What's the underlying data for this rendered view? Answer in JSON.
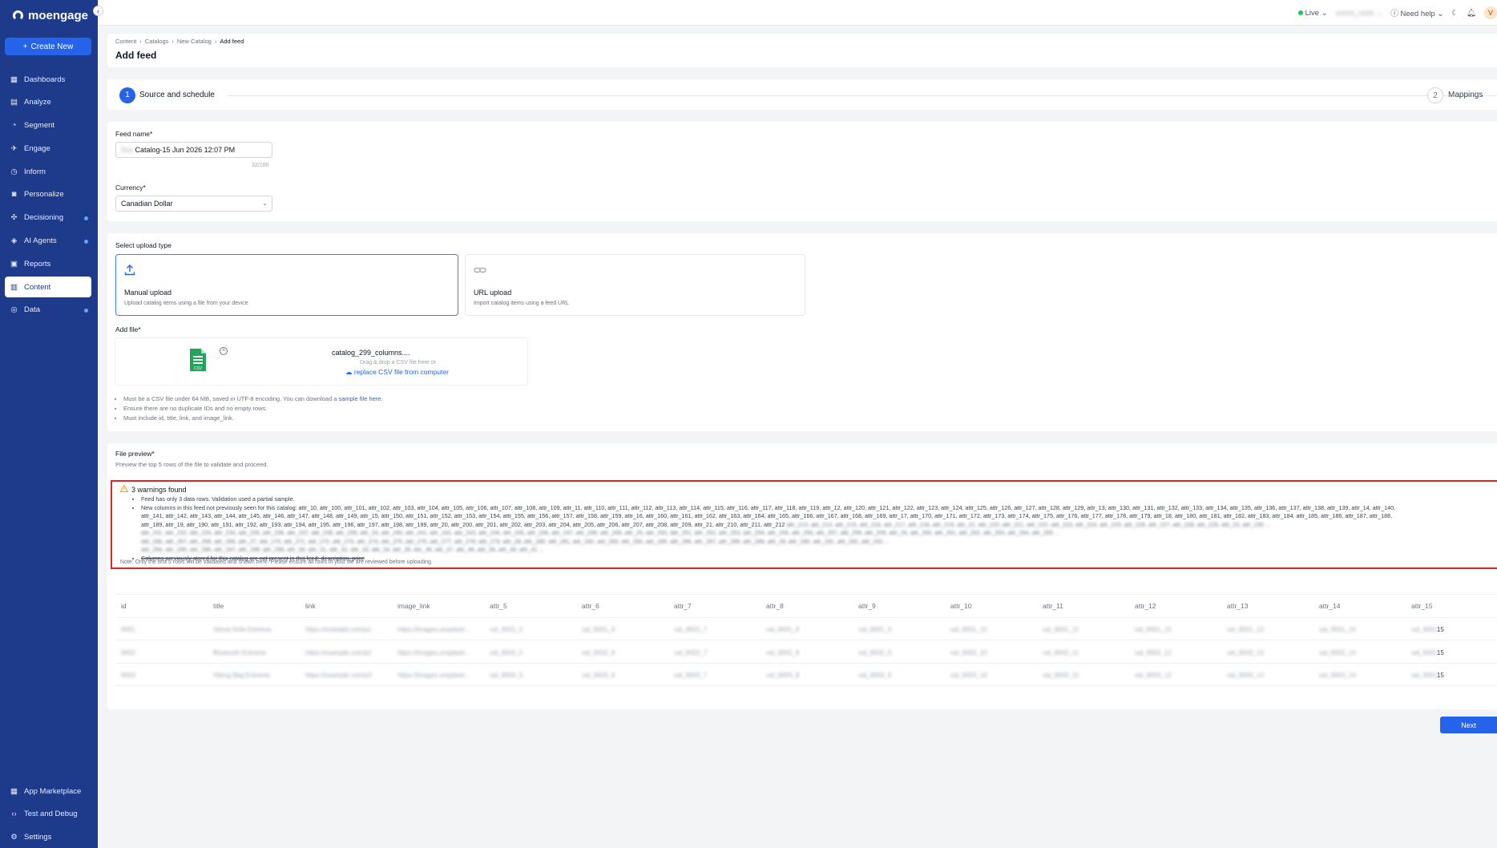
{
  "sidebar": {
    "brand": "moengage",
    "create_label": "Create New",
    "items": [
      {
        "label": "Dashboards",
        "icon": "dashboard-icon"
      },
      {
        "label": "Analyze",
        "icon": "analyze-icon"
      },
      {
        "label": "Segment",
        "icon": "segment-icon"
      },
      {
        "label": "Engage",
        "icon": "engage-icon"
      },
      {
        "label": "Inform",
        "icon": "inform-icon"
      },
      {
        "label": "Personalize",
        "icon": "personalize-icon"
      },
      {
        "label": "Decisioning",
        "icon": "decisioning-icon"
      },
      {
        "label": "AI Agents",
        "icon": "ai-agents-icon"
      },
      {
        "label": "Reports",
        "icon": "reports-icon"
      },
      {
        "label": "Content",
        "icon": "content-icon"
      },
      {
        "label": "Data",
        "icon": "data-icon"
      }
    ],
    "bottom_items": [
      {
        "label": "App Marketplace",
        "icon": "marketplace-icon"
      },
      {
        "label": "Test and Debug",
        "icon": "code-icon"
      },
      {
        "label": "Settings",
        "icon": "gear-icon"
      }
    ]
  },
  "topbar": {
    "env": "Live",
    "need_help": "Need help",
    "avatar_initial": "V"
  },
  "header": {
    "breadcrumb": [
      "Content",
      "Catalogs",
      "New Catalog",
      "Add feed"
    ],
    "title": "Add feed"
  },
  "stepper": {
    "step1_num": "1",
    "step1_label": "Source and schedule",
    "step2_num": "2",
    "step2_label": "Mappings"
  },
  "form": {
    "feed_name_label": "Feed name*",
    "feed_name_value": "Catalog-15 Jun 2026 12:07 PM",
    "feed_name_counter": "32/100",
    "currency_label": "Currency*",
    "currency_value": "Canadian Dollar"
  },
  "upload": {
    "section_label": "Select upload type",
    "manual_title": "Manual upload",
    "manual_desc": "Upload catalog items using a file from your device",
    "url_title": "URL upload",
    "url_desc": "Import catalog items using a feed URL",
    "add_file_label": "Add file*",
    "file_name": "catalog_299_columns....",
    "drag_text": "Drag & drop a CSV file here or",
    "replace_label": "replace CSV file from computer",
    "rule1_prefix": "Must be a CSV file under 64 MB, saved in UTF-8 encoding. You can download a",
    "rule1_link": "sample file here.",
    "rule2": "Ensure there are no duplicate IDs and no empty rows.",
    "rule3": "Must include id, title, link, and image_link."
  },
  "preview": {
    "label": "File preview*",
    "desc": "Preview the top 5 rows of the file to validate and proceed.",
    "warning_title": "3 warnings found",
    "warning1": "Feed has only 3 data rows. Validation used a partial sample.",
    "warning2_a": "New columns in this feed not previously seen for this catalog: attr_10, attr_100, attr_101, attr_102, attr_103, attr_104, attr_105, attr_106, attr_107, attr_108, attr_109, attr_11, attr_110, attr_111, attr_112, attr_113, attr_114, attr_115, attr_116, attr_117, attr_118, attr_119, attr_12, attr_120, attr_121, attr_122, attr_123, attr_124, attr_125, attr_126, attr_127, attr_128, attr_129, attr_13, attr_130, attr_131, attr_132, attr_133, attr_134, attr_135, attr_136, attr_137, attr_138, attr_139, attr_14, attr_140,",
    "warning2_b": "attr_141, attr_142, attr_143, attr_144, attr_145, attr_146, attr_147, attr_148, attr_149, attr_15, attr_150, attr_151, attr_152, attr_153, attr_154, attr_155, attr_156, attr_157, attr_158, attr_159, attr_16, attr_160, attr_161, attr_162, attr_163, attr_164, attr_165, attr_166, attr_167, attr_168, attr_169, attr_17, attr_170, attr_171, attr_172, attr_173, attr_174, attr_175, attr_176, attr_177, attr_178, attr_179, attr_18, attr_180, attr_181, attr_182, attr_183, attr_184, attr_185, attr_186, attr_187, attr_188,",
    "warning2_c": "attr_189, attr_19, attr_190, attr_191, attr_192, attr_193, attr_194, attr_195, attr_196, attr_197, attr_198, attr_199, attr_20, attr_200, attr_201, attr_202, attr_203, attr_204, attr_205, attr_206, attr_207, attr_208, attr_209, attr_21, attr_210, attr_211, attr_212",
    "warning3": "Columns previously stored for this catalog are not present in this feed: description, price",
    "note": "Note: Only the first 5 rows will be validated and shown here. Please ensure all rows in your file are reviewed before uploading.",
    "columns": [
      "id",
      "title",
      "link",
      "image_link",
      "attr_5",
      "attr_6",
      "attr_7",
      "attr_8",
      "attr_9",
      "attr_10",
      "attr_11",
      "attr_12",
      "attr_13",
      "attr_14",
      "attr_15"
    ],
    "rows": [
      [
        "9001",
        "Velvet Sofa Extreme",
        "https://example.com/p1",
        "https://images.unsplash...",
        "val_9001_5",
        "val_9001_6",
        "val_9001_7",
        "val_9001_8",
        "val_9001_9",
        "val_9001_10",
        "val_9001_11",
        "val_9001_12",
        "val_9001_13",
        "val_9001_14",
        "val_9001_15"
      ],
      [
        "9002",
        "Bluetooth Extreme",
        "https://example.com/p2",
        "https://images.unsplash...",
        "val_9002_5",
        "val_9002_6",
        "val_9002_7",
        "val_9002_8",
        "val_9002_9",
        "val_9002_10",
        "val_9002_11",
        "val_9002_12",
        "val_9002_13",
        "val_9002_14",
        "val_9002_15"
      ],
      [
        "9003",
        "Hiking Bag Extreme",
        "https://example.com/p3",
        "https://images.unsplash...",
        "val_9003_5",
        "val_9003_6",
        "val_9003_7",
        "val_9003_8",
        "val_9003_9",
        "val_9003_10",
        "val_9003_11",
        "val_9003_12",
        "val_9003_13",
        "val_9003_14",
        "val_9003_15"
      ]
    ],
    "row_tail": "15"
  },
  "footer": {
    "next_label": "Next"
  },
  "colors": {
    "sidebar": "#1e3a8a",
    "primary": "#2563eb",
    "warning_border": "#dc2626"
  }
}
